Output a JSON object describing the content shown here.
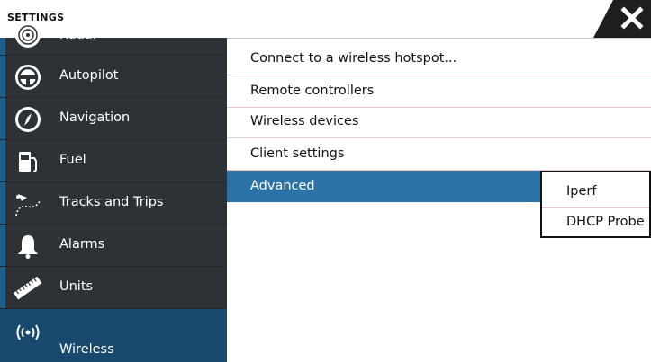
{
  "header": {
    "title": "SETTINGS"
  },
  "sidebar": {
    "items": [
      {
        "label": "Radar",
        "icon": "radar-icon"
      },
      {
        "label": "Autopilot",
        "icon": "steering-wheel-icon"
      },
      {
        "label": "Navigation",
        "icon": "compass-icon"
      },
      {
        "label": "Fuel",
        "icon": "fuel-pump-icon"
      },
      {
        "label": "Tracks and Trips",
        "icon": "track-icon"
      },
      {
        "label": "Alarms",
        "icon": "bell-icon"
      },
      {
        "label": "Units",
        "icon": "ruler-icon"
      },
      {
        "label": "Wireless",
        "icon": "wireless-icon",
        "selected": true
      }
    ]
  },
  "main": {
    "items": [
      {
        "label": "Connect to a wireless hotspot..."
      },
      {
        "label": "Remote controllers"
      },
      {
        "label": "Wireless devices"
      },
      {
        "label": "Client settings"
      },
      {
        "label": "Advanced",
        "active": true
      }
    ]
  },
  "popup": {
    "items": [
      {
        "label": "Iperf"
      },
      {
        "label": "DHCP Probe"
      }
    ]
  },
  "colors": {
    "sidebar_bg": "#2d3237",
    "sidebar_selected": "#174a6e",
    "main_active": "#2b73a6",
    "divider": "#e6c8c8"
  }
}
